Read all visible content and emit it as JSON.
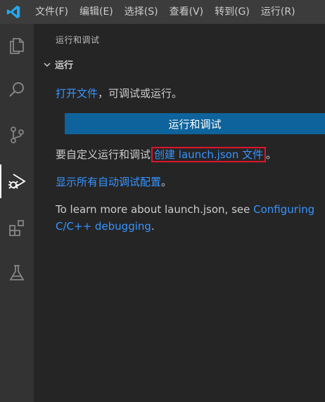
{
  "menubar": {
    "items": [
      "文件(F)",
      "编辑(E)",
      "选择(S)",
      "查看(V)",
      "转到(G)",
      "运行(R)"
    ]
  },
  "activity_icons": [
    "explorer-icon",
    "search-icon",
    "source-control-icon",
    "run-debug-icon",
    "extensions-icon",
    "testing-icon"
  ],
  "sidebar": {
    "title": "运行和调试",
    "section": {
      "label": "运行",
      "open_file_link": "打开文件",
      "open_file_suffix": "，可调试或运行。",
      "run_button_label": "运行和调试",
      "customize_prefix": "要自定义运行和调试",
      "create_launch_link": "创建 launch.json 文件",
      "customize_suffix": "。",
      "show_all_link": "显示所有自动调试配置",
      "show_all_suffix": "。",
      "learn_more_prefix": "To learn more about launch.json, see ",
      "learn_more_link": "Configuring C/C++ debugging",
      "learn_more_suffix": "."
    }
  },
  "colors": {
    "accent_blue": "#0e639c",
    "link": "#3794ff",
    "highlight_red": "#e0142a"
  }
}
